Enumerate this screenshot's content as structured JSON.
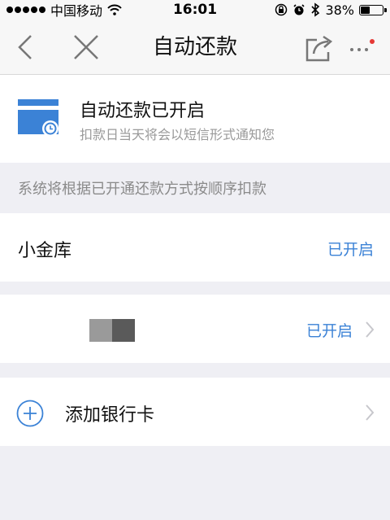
{
  "status_bar": {
    "carrier": "中国移动",
    "time": "16:01",
    "battery": "38%",
    "battery_level": 0.38
  },
  "navbar": {
    "title": "自动还款"
  },
  "header_card": {
    "title": "自动还款已开启",
    "subtitle": "扣款日当天将会以短信形式通知您",
    "icon": "card-clock-icon",
    "accent": "#3b82d6"
  },
  "info": "系统将根据已开通还款方式按顺序扣款",
  "methods": [
    {
      "label": "小金库",
      "status": "已开启"
    },
    {
      "label": "",
      "status": "已开启"
    }
  ],
  "add_card": {
    "label": "添加银行卡"
  },
  "colors": {
    "accent": "#3b82d6",
    "background": "#efeff4",
    "badge": "#e53935"
  }
}
